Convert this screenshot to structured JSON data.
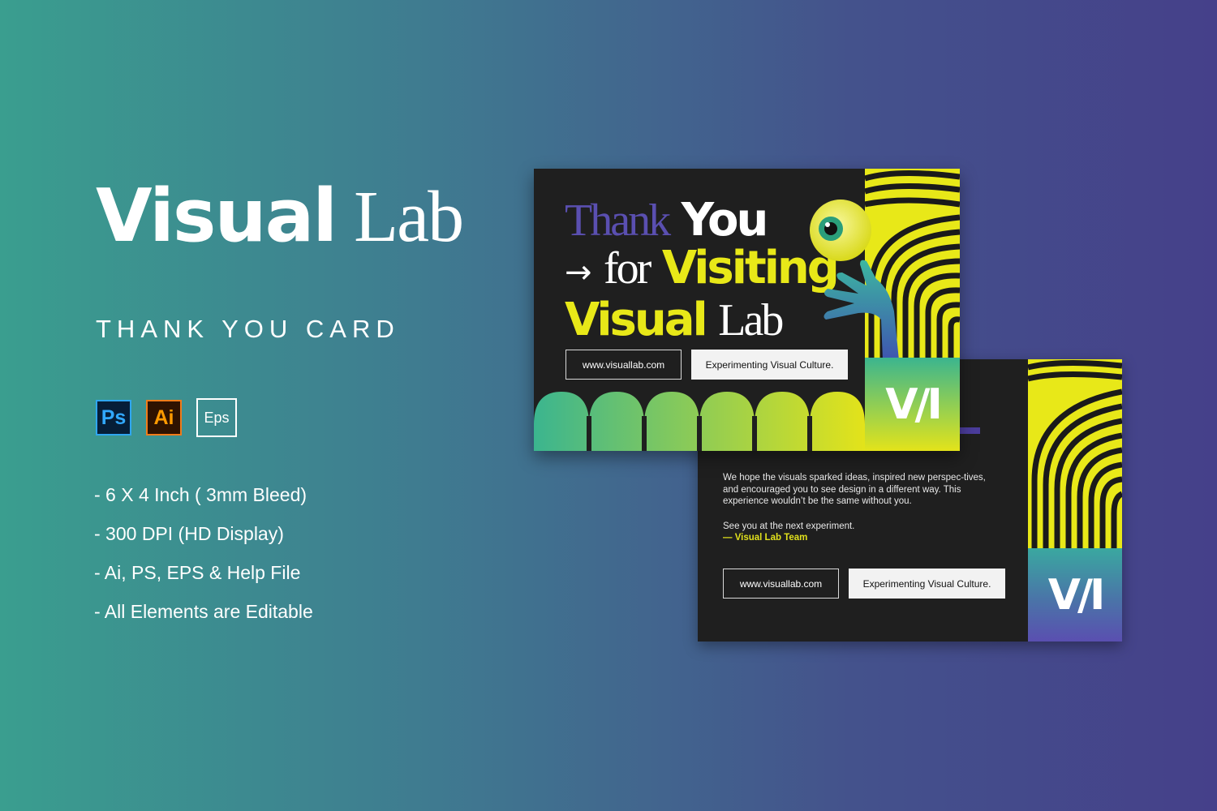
{
  "product": {
    "title_word1": "Visual",
    "title_word2": "Lab",
    "subtitle": "THANK YOU CARD"
  },
  "badges": [
    {
      "label": "Ps",
      "icon": "photoshop-icon"
    },
    {
      "label": "Ai",
      "icon": "illustrator-icon"
    },
    {
      "label": "Eps",
      "icon": "eps-icon"
    }
  ],
  "features": [
    "- 6 X 4 Inch ( 3mm Bleed)",
    "- 300 DPI (HD Display)",
    "- Ai, PS, EPS & Help File",
    "- All Elements are Editable"
  ],
  "front_card": {
    "thank": "Thank",
    "you": "You",
    "arrow": "→",
    "for": "for",
    "visiting": "Visiting",
    "visual": "Visual",
    "lab": "Lab",
    "website": "www.visuallab.com",
    "tagline": "Experimenting Visual Culture.",
    "logo": "V/I"
  },
  "back_card": {
    "message": "We hope the visuals sparked ideas, inspired new perspec-tives, and encouraged you to see design in a different way. This experience wouldn’t be the same without you.",
    "closing": "See you at the next experiment.",
    "signoff": "— Visual Lab Team",
    "website": "www.visuallab.com",
    "tagline": "Experimenting Visual Culture.",
    "logo": "V/I"
  },
  "colors": {
    "bg_left": "#3a9e8f",
    "bg_right": "#45408a",
    "card_bg": "#1f1f1f",
    "accent_yellow": "#e8e818",
    "accent_purple": "#5a4fb0",
    "teal": "#3bb58f"
  }
}
